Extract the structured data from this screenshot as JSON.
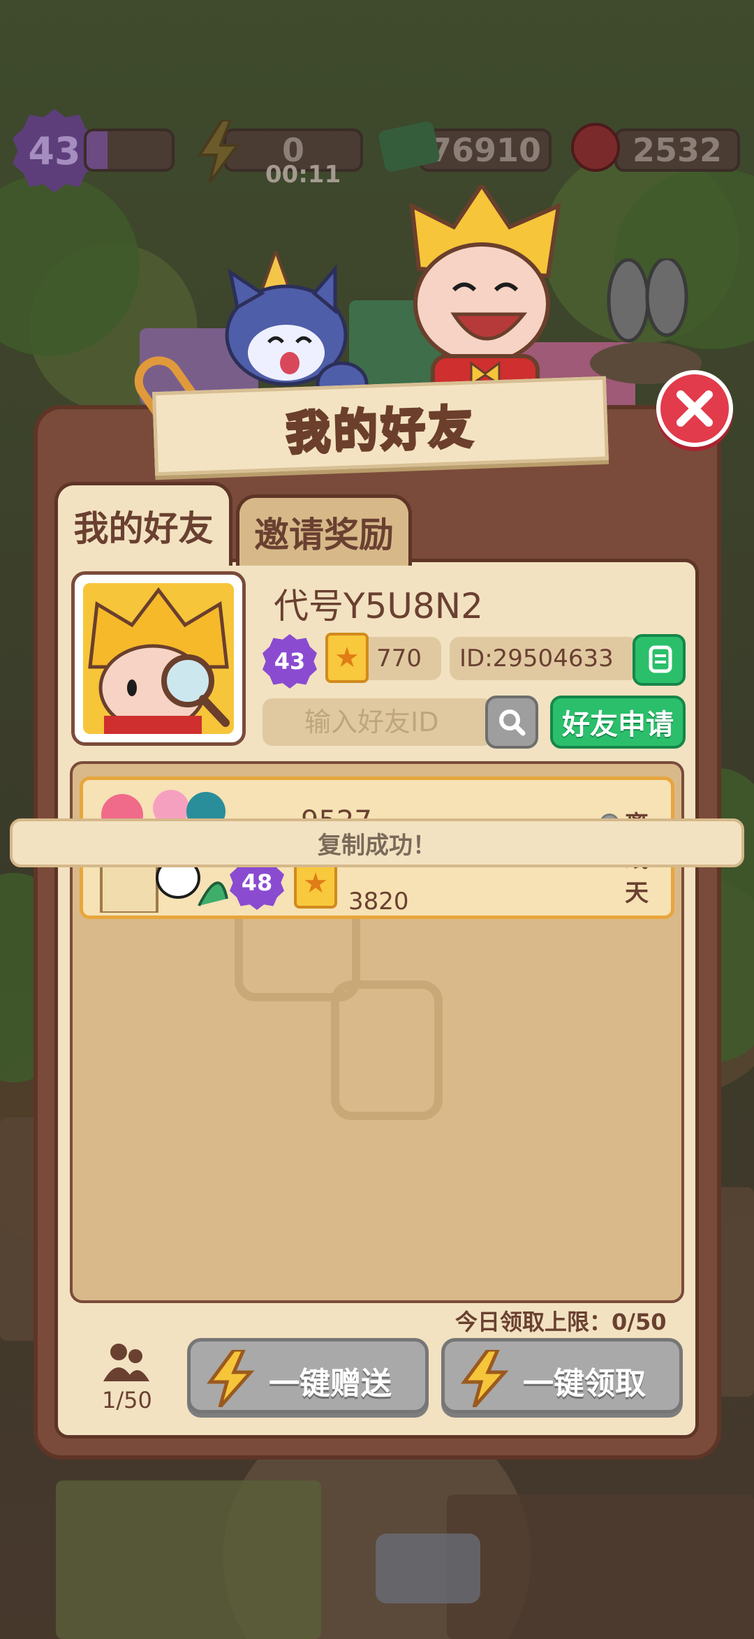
{
  "hud": {
    "level": "43",
    "energy": "0",
    "energy_timer": "00:11",
    "cash": "76910",
    "gems": "2532"
  },
  "title": "我的好友",
  "tabs": [
    {
      "label": "我的好友",
      "active": true
    },
    {
      "label": "邀请奖励",
      "active": false
    }
  ],
  "profile": {
    "nickname": "代号Y5U8N2",
    "level": "43",
    "stars": "770",
    "id_label": "ID:29504633"
  },
  "search": {
    "placeholder": "输入好友ID",
    "apply_label": "好友申请"
  },
  "friends": [
    {
      "name": "9527",
      "status": "离线1天",
      "level": "48",
      "stars": "3820"
    }
  ],
  "toast": "复制成功！",
  "footer": {
    "daily_limit": "今日领取上限：0/50",
    "friend_count": "1/50",
    "send_all_label": "一键赠送",
    "claim_all_label": "一键领取"
  },
  "icons": {
    "close": "close-icon",
    "copy": "copy-icon",
    "search": "search-icon",
    "status": "offline-dot-icon",
    "friends": "people-icon",
    "lightning": "lightning-icon",
    "star_card": "star-card-icon",
    "level_badge": "level-badge-icon"
  },
  "colors": {
    "panel": "#7a4b3a",
    "panel_inner": "#f2e2c1",
    "accent_green": "#2bbf6b",
    "close_red": "#e23b4b",
    "level_purple": "#8a4bd1",
    "highlight_orange": "#e7a63c"
  }
}
